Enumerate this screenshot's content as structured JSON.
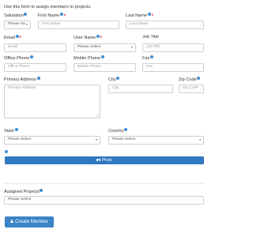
{
  "intro": {
    "prefix": "Use this form to assign ",
    "emphasis": "members",
    "suffix": " to projects."
  },
  "fields": {
    "salutation": {
      "label": "Salutation",
      "value": "Please Se"
    },
    "first_name": {
      "label": "First Name",
      "placeholder": "First Name"
    },
    "last_name": {
      "label": "Last Name",
      "placeholder": "Last Name"
    },
    "email": {
      "label": "Email",
      "placeholder": "Email"
    },
    "user_name": {
      "label": "User Name",
      "value": "Please Select"
    },
    "job_title": {
      "label": "Job Title",
      "placeholder": "Job Title"
    },
    "office_phone": {
      "label": "Office Phone",
      "placeholder": "Office Phone"
    },
    "mobile_phone": {
      "label": "Mobile Phone",
      "placeholder": "Mobile Phone"
    },
    "fax": {
      "label": "Fax",
      "placeholder": "Fax"
    },
    "primary_address": {
      "label": "Primary Address",
      "placeholder": "Primary Address"
    },
    "city": {
      "label": "City",
      "placeholder": "City"
    },
    "zip_code": {
      "label": "Zip Code",
      "placeholder": "Zip Code"
    },
    "state": {
      "label": "State",
      "value": "Please Select"
    },
    "country": {
      "label": "Country",
      "value": "Please Select"
    },
    "assigned_projects": {
      "label": "Assigned Projects",
      "value": "Please Select"
    }
  },
  "photo_button": {
    "label": "Photo"
  },
  "create_button": {
    "label": "Create Member"
  },
  "colors": {
    "primary": "#3177c1",
    "required": "#e02020",
    "info": "#3d8fd6"
  }
}
